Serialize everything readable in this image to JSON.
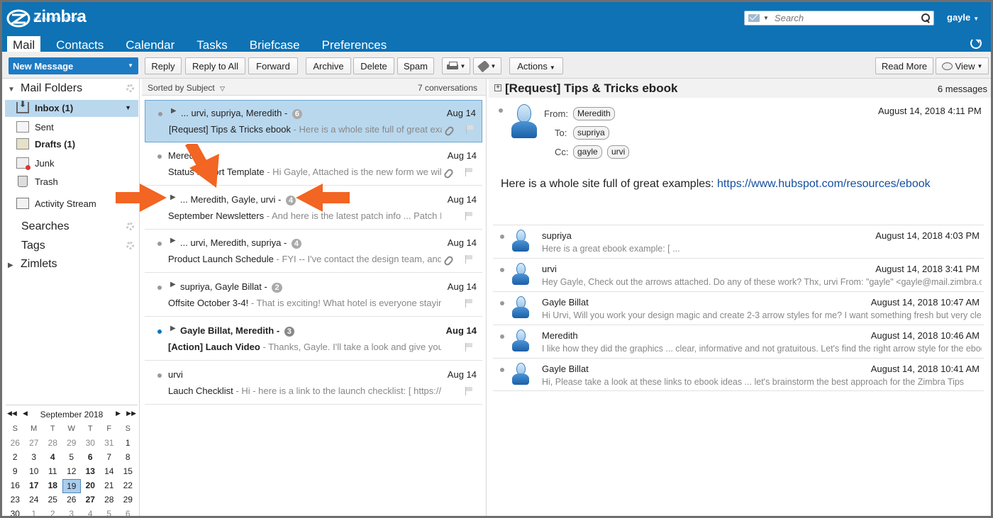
{
  "app": {
    "logo_text": "zimbra",
    "logo_sub": "A SYNACOR PRODUCT",
    "user_name": "gayle",
    "search_placeholder": "Search"
  },
  "tabs": [
    {
      "label": "Mail",
      "active": true
    },
    {
      "label": "Contacts"
    },
    {
      "label": "Calendar"
    },
    {
      "label": "Tasks"
    },
    {
      "label": "Briefcase"
    },
    {
      "label": "Preferences"
    }
  ],
  "toolbar": {
    "new_message": "New Message",
    "reply": "Reply",
    "reply_all": "Reply to All",
    "forward": "Forward",
    "archive": "Archive",
    "delete": "Delete",
    "spam": "Spam",
    "actions": "Actions",
    "read_more": "Read More",
    "view": "View"
  },
  "sidebar": {
    "mail_folders": "Mail Folders",
    "folders": [
      {
        "label": "Inbox (1)",
        "selected": true
      },
      {
        "label": "Sent"
      },
      {
        "label": "Drafts (1)",
        "bold": true
      },
      {
        "label": "Junk"
      },
      {
        "label": "Trash"
      },
      {
        "label": "Activity Stream"
      }
    ],
    "searches": "Searches",
    "tags": "Tags",
    "zimlets": "Zimlets"
  },
  "calendar": {
    "month": "September 2018",
    "dow": [
      "S",
      "M",
      "T",
      "W",
      "T",
      "F",
      "S"
    ],
    "weeks": [
      [
        "26",
        "27",
        "28",
        "29",
        "30",
        "31",
        "1"
      ],
      [
        "2",
        "3",
        "4",
        "5",
        "6",
        "7",
        "8"
      ],
      [
        "9",
        "10",
        "11",
        "12",
        "13",
        "14",
        "15"
      ],
      [
        "16",
        "17",
        "18",
        "19",
        "20",
        "21",
        "22"
      ],
      [
        "23",
        "24",
        "25",
        "26",
        "27",
        "28",
        "29"
      ],
      [
        "30",
        "1",
        "2",
        "3",
        "4",
        "5",
        "6"
      ]
    ],
    "today": "19"
  },
  "list": {
    "sorted_by": "Sorted by Subject",
    "count": "7 conversations",
    "conversations": [
      {
        "from": "... urvi, supriya, Meredith -",
        "count": "6",
        "date": "Aug 14",
        "subject": "[Request] Tips & Tricks ebook",
        "fragment": " - Here is a whole site full of great examples",
        "expandable": true,
        "selected": true,
        "attachment": true,
        "unread": false
      },
      {
        "from": "Meredith",
        "count": "",
        "date": "Aug 14",
        "subject": "Status Report Template",
        "fragment": " - Hi Gayle, Attached is the new form we will be using",
        "expandable": false,
        "attachment": true
      },
      {
        "from": "... Meredith, Gayle, urvi -",
        "count": "4",
        "date": "Aug 14",
        "subject": "September Newsletters",
        "fragment": " - And here is the latest patch info ... Patch Info",
        "expandable": true,
        "attachment": false
      },
      {
        "from": "... urvi, Meredith, supriya -",
        "count": "4",
        "date": "Aug 14",
        "subject": "Product Launch Schedule",
        "fragment": " - FYI -- I've contact the design team, and they",
        "expandable": true,
        "attachment": true
      },
      {
        "from": "supriya, Gayle Billat -",
        "count": "2",
        "date": "Aug 14",
        "subject": "Offsite October 3-4!",
        "fragment": " - That is exciting! What hotel is everyone staying in?",
        "expandable": true,
        "attachment": false
      },
      {
        "from": "Gayle Billat, Meredith -",
        "count": "3",
        "date": "Aug 14",
        "subject": "[Action] Lauch Video",
        "fragment": " - Thanks, Gayle. I'll take a look and give you feedback",
        "expandable": true,
        "attachment": false,
        "unread": true
      },
      {
        "from": "urvi",
        "count": "",
        "date": "Aug 14",
        "subject": "Lauch Checklist",
        "fragment": " - Hi - here is a link to the launch checklist: [ https://www.",
        "expandable": false,
        "attachment": false
      }
    ]
  },
  "reading": {
    "title": "[Request] Tips & Tricks ebook",
    "messages_count": "6 messages",
    "from_label": "From:",
    "to_label": "To:",
    "cc_label": "Cc:",
    "from": "Meredith",
    "to": "supriya",
    "cc": [
      "gayle",
      "urvi"
    ],
    "date": "August 14, 2018 4:11 PM",
    "body": "Here is a whole site full of great examples: ",
    "link": "https://www.hubspot.com/resources/ebook",
    "thread": [
      {
        "sender": "supriya",
        "date": "August 14, 2018 4:03 PM",
        "preview": "Here is a great ebook example: [ ..."
      },
      {
        "sender": "urvi",
        "date": "August 14, 2018 3:41 PM",
        "preview": "Hey Gayle, Check out the arrows attached. Do any of these work? Thx, urvi From: \"gayle\" <gayle@mail.zimbra.com>"
      },
      {
        "sender": "Gayle Billat",
        "date": "August 14, 2018 10:47 AM",
        "preview": "Hi Urvi, Will you work your design magic and create 2-3 arrow styles for me? I want something fresh but very clean"
      },
      {
        "sender": "Meredith",
        "date": "August 14, 2018 10:46 AM",
        "preview": "I like how they did the graphics ... clear, informative and not gratuitous. Let's find the right arrow style for the ebook"
      },
      {
        "sender": "Gayle Billat",
        "date": "August 14, 2018 10:41 AM",
        "preview": "Hi, Please take a look at these links to ebook ideas ... let's brainstorm the best approach for the Zimbra Tips"
      }
    ]
  },
  "colors": {
    "header_blue": "#0e72b5",
    "selection_blue": "#b9d8ee",
    "annotation_orange": "#f26522"
  }
}
